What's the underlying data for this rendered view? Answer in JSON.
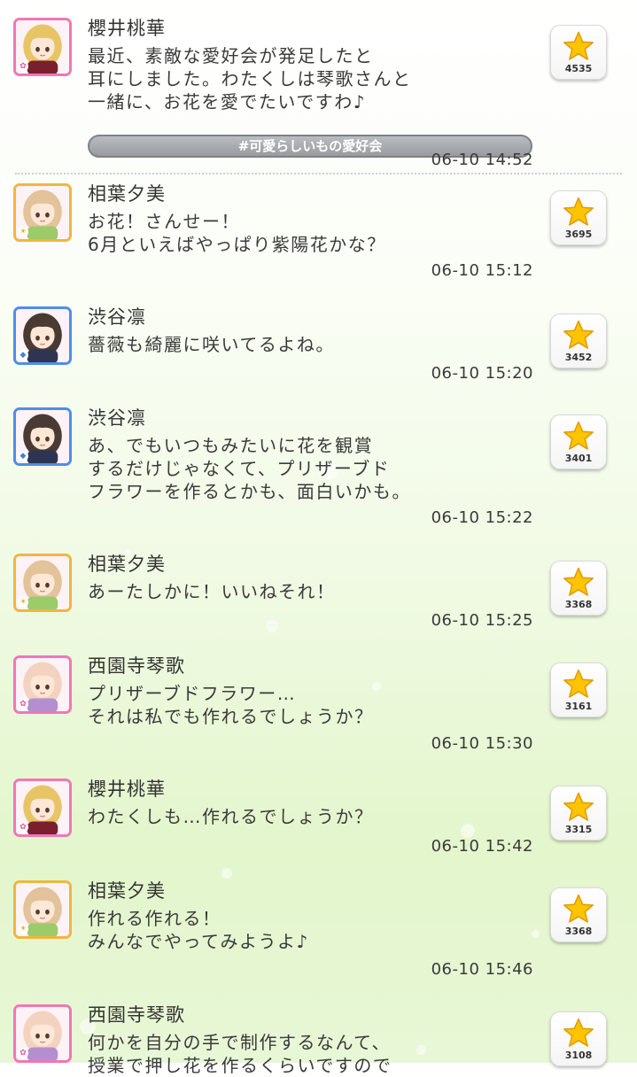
{
  "posts": [
    {
      "author": "櫻井桃華",
      "attribute": "cute",
      "avatar": {
        "hair": "#e7c566",
        "accent": "#7a1f2e",
        "frame": "#f078b4"
      },
      "message": "最近、素敵な愛好会が発足したと\n耳にしました。わたくしは琴歌さんと\n一緒に、お花を愛でたいですわ♪",
      "tag": "#可愛らしいもの愛好会",
      "time": "06-10 14:52",
      "likes": "4535"
    },
    {
      "author": "相葉夕美",
      "attribute": "passion",
      "avatar": {
        "hair": "#e2c39a",
        "accent": "#9ccb6a",
        "frame": "#f1b640"
      },
      "message": "お花！さんせー！\n6月といえばやっぱり紫陽花かな？",
      "time": "06-10 15:12",
      "likes": "3695"
    },
    {
      "author": "渋谷凛",
      "attribute": "cool",
      "avatar": {
        "hair": "#4a3a34",
        "accent": "#2f3550",
        "frame": "#4f8ee6"
      },
      "message": "薔薇も綺麗に咲いてるよね。",
      "time": "06-10 15:20",
      "likes": "3452"
    },
    {
      "author": "渋谷凛",
      "attribute": "cool",
      "avatar": {
        "hair": "#4a3a34",
        "accent": "#2f3550",
        "frame": "#4f8ee6"
      },
      "message": "あ、でもいつもみたいに花を観賞\nするだけじゃなくて、プリザーブド\nフラワーを作るとかも、面白いかも。",
      "time": "06-10 15:22",
      "likes": "3401"
    },
    {
      "author": "相葉夕美",
      "attribute": "passion",
      "avatar": {
        "hair": "#e2c39a",
        "accent": "#9ccb6a",
        "frame": "#f1b640"
      },
      "message": "あーたしかに！いいねそれ！",
      "time": "06-10 15:25",
      "likes": "3368"
    },
    {
      "author": "西園寺琴歌",
      "attribute": "cute",
      "avatar": {
        "hair": "#f3d2c0",
        "accent": "#b48fd0",
        "frame": "#f078b4"
      },
      "message": "プリザーブドフラワー…\nそれは私でも作れるでしょうか？",
      "time": "06-10 15:30",
      "likes": "3161"
    },
    {
      "author": "櫻井桃華",
      "attribute": "cute",
      "avatar": {
        "hair": "#e7c566",
        "accent": "#7a1f2e",
        "frame": "#f078b4"
      },
      "message": "わたくしも…作れるでしょうか？",
      "time": "06-10 15:42",
      "likes": "3315"
    },
    {
      "author": "相葉夕美",
      "attribute": "passion",
      "avatar": {
        "hair": "#e2c39a",
        "accent": "#9ccb6a",
        "frame": "#f1b640"
      },
      "message": "作れる作れる！\nみんなでやってみようよ♪",
      "time": "06-10 15:46",
      "likes": "3368"
    },
    {
      "author": "西園寺琴歌",
      "attribute": "cute",
      "avatar": {
        "hair": "#f3d2c0",
        "accent": "#b48fd0",
        "frame": "#f078b4"
      },
      "message": "何かを自分の手で制作するなんて、\n授業で押し花を作るくらいですので",
      "likes": "3108"
    }
  ],
  "colors": {
    "star": "#ffc400",
    "star_stroke": "#e09a00",
    "divider": "#cfcfcf"
  }
}
